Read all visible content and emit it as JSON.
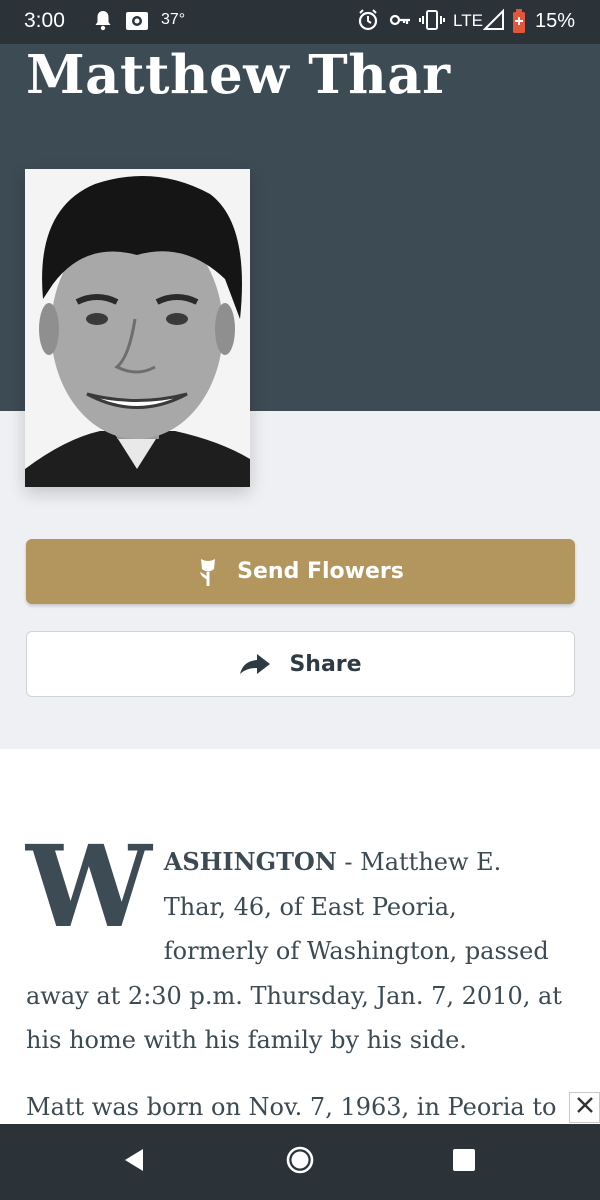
{
  "status_bar": {
    "time": "3:00",
    "temperature": "37°",
    "network": "LTE",
    "battery": "15%",
    "icons": [
      "notification-bell-icon",
      "photo-app-icon",
      "alarm-icon",
      "vpn-key-icon",
      "vibrate-icon",
      "signal-icon",
      "battery-icon"
    ]
  },
  "obituary": {
    "name": "Matthew Thar",
    "photo_alt": "Portrait of Matthew Thar"
  },
  "actions": {
    "send_flowers_label": "Send Flowers",
    "send_flowers_icon": "flower-icon",
    "share_label": "Share",
    "share_icon": "share-arrow-icon"
  },
  "article": {
    "drop_cap": "W",
    "lead_word": "ASHINGTON",
    "first_paragraph_rest": " - Matthew E. Thar, 46, of East Peoria, formerly of Washington, passed away at 2:30 p.m. Thursday, Jan. 7, 2010, at his home with his family by his side.",
    "second_paragraph": "Matt was born on Nov. 7, 1963, in Peoria to"
  },
  "ad": {
    "close_icon": "close-icon"
  },
  "navigation": {
    "icons": [
      "back-icon",
      "home-icon",
      "recents-icon"
    ]
  },
  "colors": {
    "hero_background": "#3d4b55",
    "page_background": "#eef0f3",
    "accent_gold": "#b3955e",
    "system_bar": "#2b3238"
  }
}
